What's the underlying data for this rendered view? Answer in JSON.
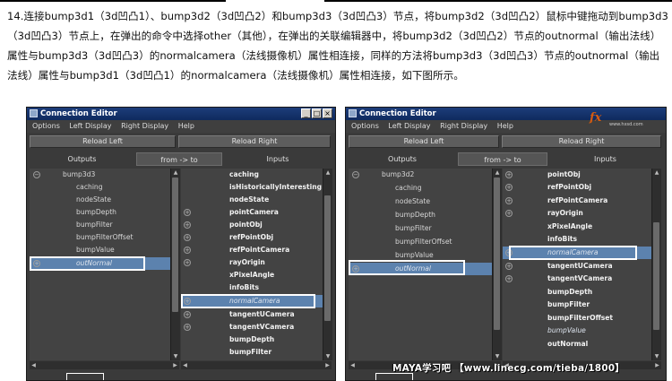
{
  "instruction_text": "14.连接bump3d1（3d凹凸1）、bump3d2（3d凹凸2）和bump3d3（3d凹凸3）节点，将bump3d2（3d凹凸2）鼠标中键拖动到bump3d3（3d凹凸3）节点上，在弹出的命令中选择other（其他），在弹出的关联编辑器中，将bump3d2（3d凹凸2）节点的outnormal（输出法线）属性与bump3d3（3d凹凸3）的normalcamera（法线摄像机）属性相连接，同样的方法将bump3d3（3d凹凸3）节点的outnormal（输出法线）属性与bump3d1（3d凹凸1）的normalcamera（法线摄像机）属性相连接，如下图所示。",
  "left_window": {
    "title": "Connection Editor",
    "menu": [
      "Options",
      "Left Display",
      "Right Display",
      "Help"
    ],
    "reload_left": "Reload Left",
    "reload_right": "Reload Right",
    "outputs_label": "Outputs",
    "direction_label": "from -> to",
    "inputs_label": "Inputs",
    "left_node": "bump3d3",
    "left_attrs": [
      "caching",
      "nodeState",
      "bumpDepth",
      "bumpFilter",
      "bumpFilterOffset",
      "bumpValue",
      "outNormal"
    ],
    "right_attrs": [
      "caching",
      "isHistoricallyInteresting",
      "nodeState",
      "pointCamera",
      "pointObj",
      "refPointObj",
      "refPointCamera",
      "rayOrigin",
      "xPixelAngle",
      "infoBits",
      "normalCamera",
      "tangentUCamera",
      "tangentVCamera",
      "bumpDepth",
      "bumpFilter"
    ]
  },
  "right_window": {
    "title": "Connection Editor",
    "menu": [
      "Options",
      "Left Display",
      "Right Display",
      "Help"
    ],
    "reload_left": "Reload Left",
    "reload_right": "Reload Right",
    "outputs_label": "Outputs",
    "direction_label": "from -> to",
    "inputs_label": "Inputs",
    "left_node": "bump3d2",
    "left_attrs": [
      "caching",
      "nodeState",
      "bumpDepth",
      "bumpFilter",
      "bumpFilterOffset",
      "bumpValue",
      "outNormal"
    ],
    "right_attrs": [
      "pointObj",
      "refPointObj",
      "refPointCamera",
      "rayOrigin",
      "xPixelAngle",
      "infoBits",
      "normalCamera",
      "tangentUCamera",
      "tangentVCamera",
      "bumpDepth",
      "bumpFilter",
      "bumpFilterOffset",
      "bumpValue",
      "outNormal"
    ]
  },
  "watermark": "MAYA学习吧 【www.linecg.com/tieba/1800】",
  "logo": {
    "text": "fx",
    "url": "www.hxsd.com"
  },
  "colors": {
    "selection": "#5c82ae",
    "titlebar": "#0f2a5e",
    "panel": "#434343",
    "logo": "#d45b10"
  }
}
